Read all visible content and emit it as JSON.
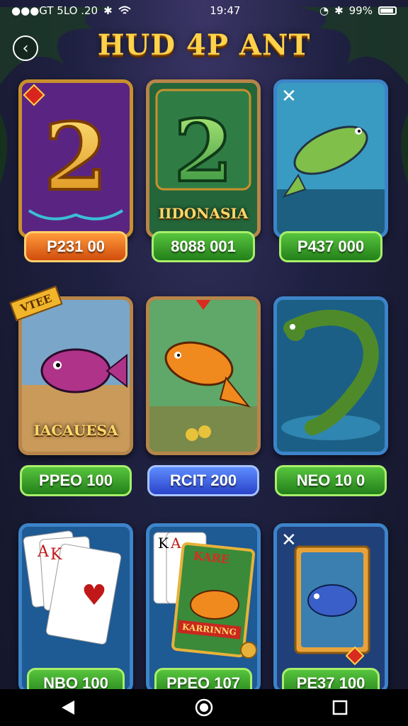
{
  "status_bar": {
    "carrier": "●●●GT 5LO .20",
    "time": "19:47",
    "battery": "99%"
  },
  "header": {
    "title": "HUD 4P ANT",
    "back_icon": "back-arrow-icon"
  },
  "tiles": [
    {
      "art": "gold-number-2",
      "caption": "",
      "price": "P231 00",
      "button_color": "orange"
    },
    {
      "art": "green-number-2",
      "caption": "IIDONASIA",
      "price": "8088 001",
      "button_color": "green"
    },
    {
      "art": "leaping-fish",
      "caption": "",
      "price": "P437 000",
      "button_color": "green"
    },
    {
      "art": "purple-fish",
      "caption": "IACAUESA",
      "badge": "VTEE",
      "price": "PPEO 100",
      "button_color": "green"
    },
    {
      "art": "orange-fish",
      "caption": "",
      "price": "RCIT 200",
      "button_color": "blue"
    },
    {
      "art": "sea-serpent",
      "caption": "",
      "price": "NEO 10 0",
      "button_color": "green"
    },
    {
      "art": "playing-cards",
      "caption": "",
      "price": "NBO 100",
      "button_color": "green"
    },
    {
      "art": "cards-and-fish",
      "caption": "",
      "card_label": "KARE",
      "ribbon": "KARRINNG",
      "price": "PPEO 107",
      "button_color": "green"
    },
    {
      "art": "fish-card",
      "caption": "",
      "price": "PE37 100",
      "button_color": "green"
    }
  ],
  "colors": {
    "title_gold": "#ffd24a",
    "button_green": "#3aa12a",
    "button_orange": "#e8661c",
    "button_blue": "#3c5fe0"
  },
  "nav": {
    "back": "nav-back-icon",
    "home": "nav-home-icon",
    "recents": "nav-recents-icon"
  }
}
